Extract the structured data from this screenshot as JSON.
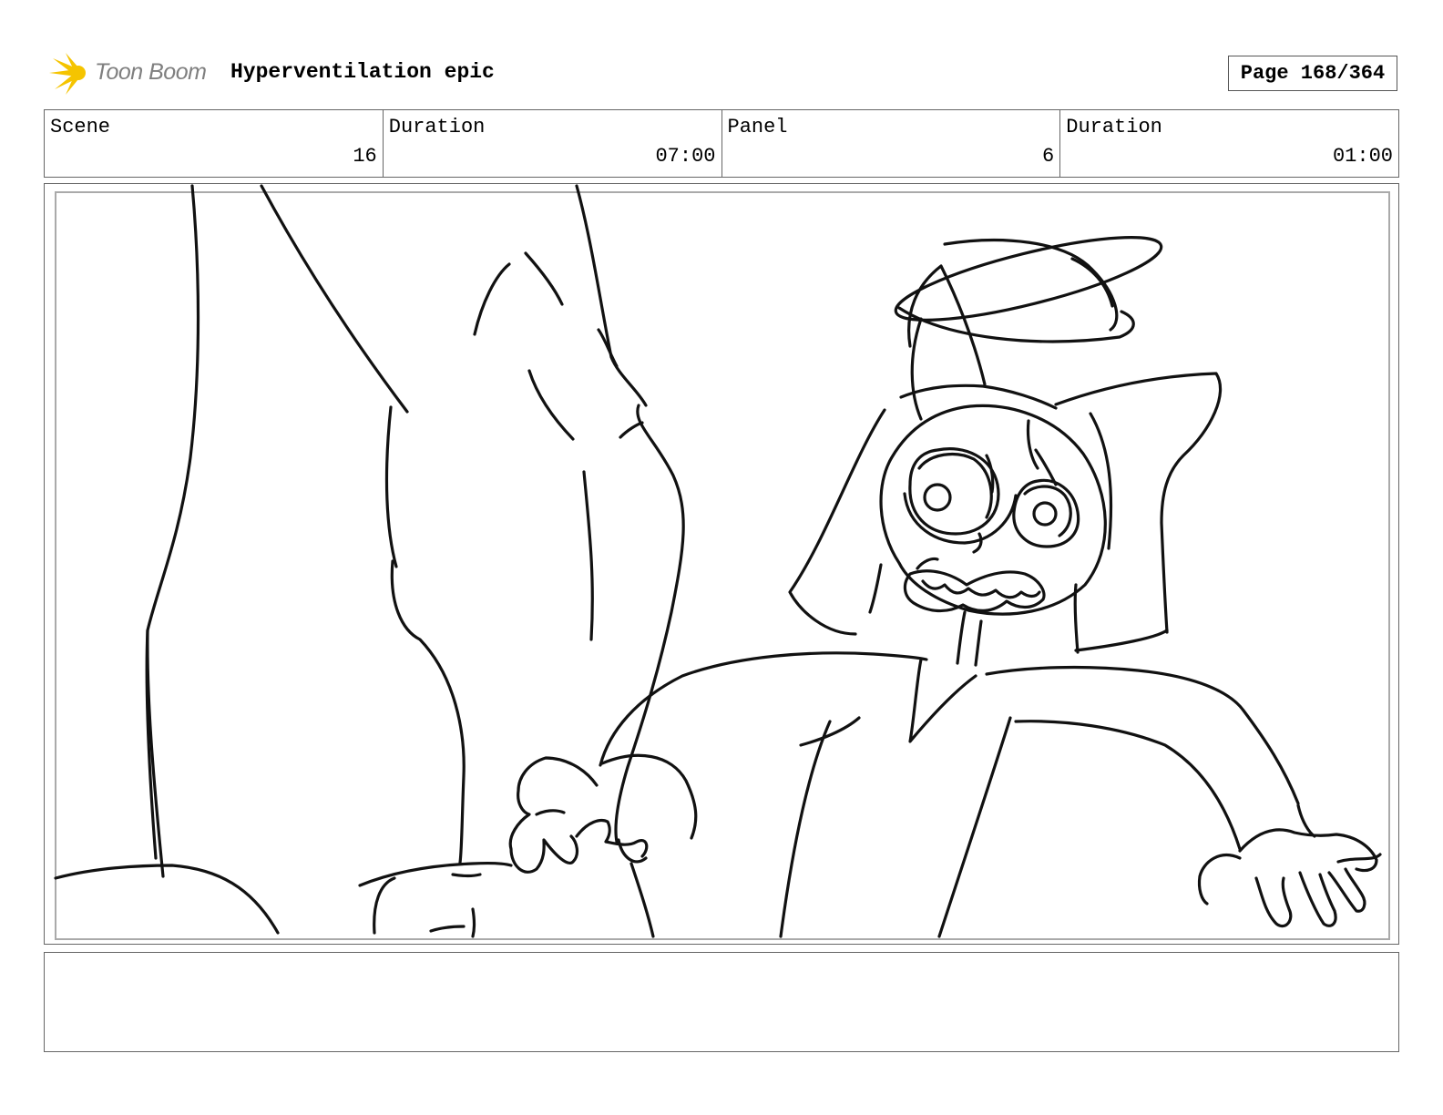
{
  "header": {
    "logo_text": "Toon Boom",
    "project_title": "Hyperventilation epic",
    "page_label": "Page 168/364"
  },
  "info": {
    "cells": [
      {
        "label": "Scene",
        "value": "16"
      },
      {
        "label": "Duration",
        "value": "07:00"
      },
      {
        "label": "Panel",
        "value": "6"
      },
      {
        "label": "Duration",
        "value": "01:00"
      }
    ]
  },
  "panel": {
    "image": "rough-sketch-character-panicking-beside-tall-figure"
  },
  "notes": {
    "text": ""
  },
  "colors": {
    "logo_yellow": "#f5c400",
    "logo_text": "#7f7f7f",
    "frame_border": "#666666",
    "inner_border": "#aaaaaa"
  }
}
